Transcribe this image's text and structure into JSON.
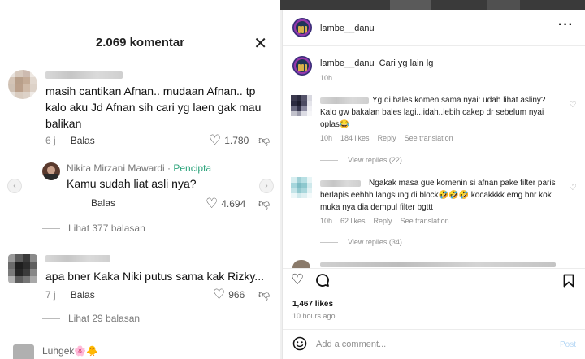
{
  "tiktok": {
    "title": "2.069 komentar",
    "close_icon": "close-icon",
    "comments": [
      {
        "text": "masih cantikan Afnan.. mudaan Afnan.. tp kalo aku Jd Afnan sih cari yg laen gak mau balikan",
        "time": "6 j",
        "reply_label": "Balas",
        "likes": "1.780"
      },
      {
        "name": "Nikita Mirzani Mawardi",
        "sep": " · ",
        "badge": "Pencipta",
        "text": "Kamu sudah liat asli nya?",
        "reply_label": "Balas",
        "likes": "4.694"
      },
      {
        "text": "apa bner Kaka Niki putus sama kak Rizky...",
        "time": "7 j",
        "reply_label": "Balas",
        "likes": "966"
      }
    ],
    "replies_1": "Lihat 377 balasan",
    "replies_2": "Lihat 29 balasan",
    "partial_name": "Luhgek🌸🐥"
  },
  "instagram": {
    "username": "lambe__danu",
    "caption_user": "lambe__danu",
    "caption": "Cari yg lain lg",
    "caption_time": "10h",
    "comments": [
      {
        "text_line1": "Yg di bales komen sama nyai: udah lihat asliny?",
        "text_line2": "Kalo gw bakalan bales lagi...idah..lebih cakep dr sebelum nyai",
        "text_line3": "oplas😂",
        "time": "10h",
        "likes": "184 likes",
        "reply": "Reply",
        "translate": "See translation",
        "view_replies": "View replies (22)"
      },
      {
        "text_line1": "Ngakak masa gue komenin si afnan pake filter paris",
        "text_line2": "berlapis eehhh langsung di block🤣🤣🤣 kocakkkk emg bnr kok",
        "text_line3": "muka nya dia dempul filter bgttt",
        "time": "10h",
        "likes": "62 likes",
        "reply": "Reply",
        "translate": "See translation",
        "view_replies": "View replies (34)"
      }
    ],
    "likes_total": "1,467 likes",
    "post_time": "10 hours ago",
    "add_comment_placeholder": "Add a comment...",
    "post_label": "Post"
  }
}
